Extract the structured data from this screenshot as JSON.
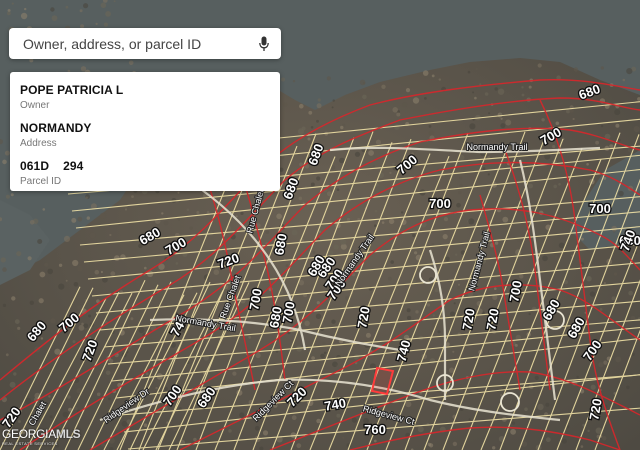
{
  "search": {
    "placeholder": "Owner, address, or parcel ID"
  },
  "icons": {
    "microphone": "microphone-icon"
  },
  "parcel": {
    "owner_value": "POPE PATRICIA L",
    "owner_label": "Owner",
    "address_value": "NORMANDY",
    "address_label": "Address",
    "parcel_map": "061D",
    "parcel_number": "294",
    "parcel_label": "Parcel ID"
  },
  "map": {
    "contours": [
      {
        "label": "680"
      },
      {
        "label": "700"
      },
      {
        "label": "680"
      },
      {
        "label": "700"
      },
      {
        "label": "680"
      },
      {
        "label": "700"
      },
      {
        "label": "720"
      },
      {
        "label": "700"
      },
      {
        "label": "680"
      },
      {
        "label": "680"
      },
      {
        "label": "700"
      },
      {
        "label": "700"
      },
      {
        "label": "680"
      },
      {
        "label": "720"
      },
      {
        "label": "700"
      },
      {
        "label": "680"
      },
      {
        "label": "700"
      },
      {
        "label": "680"
      },
      {
        "label": "680"
      },
      {
        "label": "700"
      },
      {
        "label": "720"
      },
      {
        "label": "740"
      },
      {
        "label": "720"
      },
      {
        "label": "740"
      },
      {
        "label": "720"
      },
      {
        "label": "740"
      },
      {
        "label": "760"
      },
      {
        "label": "720"
      },
      {
        "label": "700"
      },
      {
        "label": "680"
      },
      {
        "label": "680"
      },
      {
        "label": "700"
      },
      {
        "label": "720"
      },
      {
        "label": "740"
      },
      {
        "label": "680"
      },
      {
        "label": "700"
      },
      {
        "label": "680"
      },
      {
        "label": "700"
      },
      {
        "label": "720"
      }
    ],
    "streets": [
      {
        "label": "Normandy Trail"
      },
      {
        "label": "Normandy Trail"
      },
      {
        "label": "Normandy Trail"
      },
      {
        "label": "Normandy Trail"
      },
      {
        "label": "Rue Chalet"
      },
      {
        "label": "Rue Chalet"
      },
      {
        "label": "Ridgeview Ct"
      },
      {
        "label": "Ridgeview Ct"
      },
      {
        "label": "Ridgeview Dr"
      },
      {
        "label": "Chalet"
      }
    ],
    "highlight_color": "#ff3b3b",
    "contour_color": "#d9262b",
    "parcel_line_color": "#f3e6b0"
  },
  "brand": {
    "name_main": "GEORGIA",
    "name_mls": "MLS",
    "tagline": "REAL ESTATE SERVICES"
  }
}
